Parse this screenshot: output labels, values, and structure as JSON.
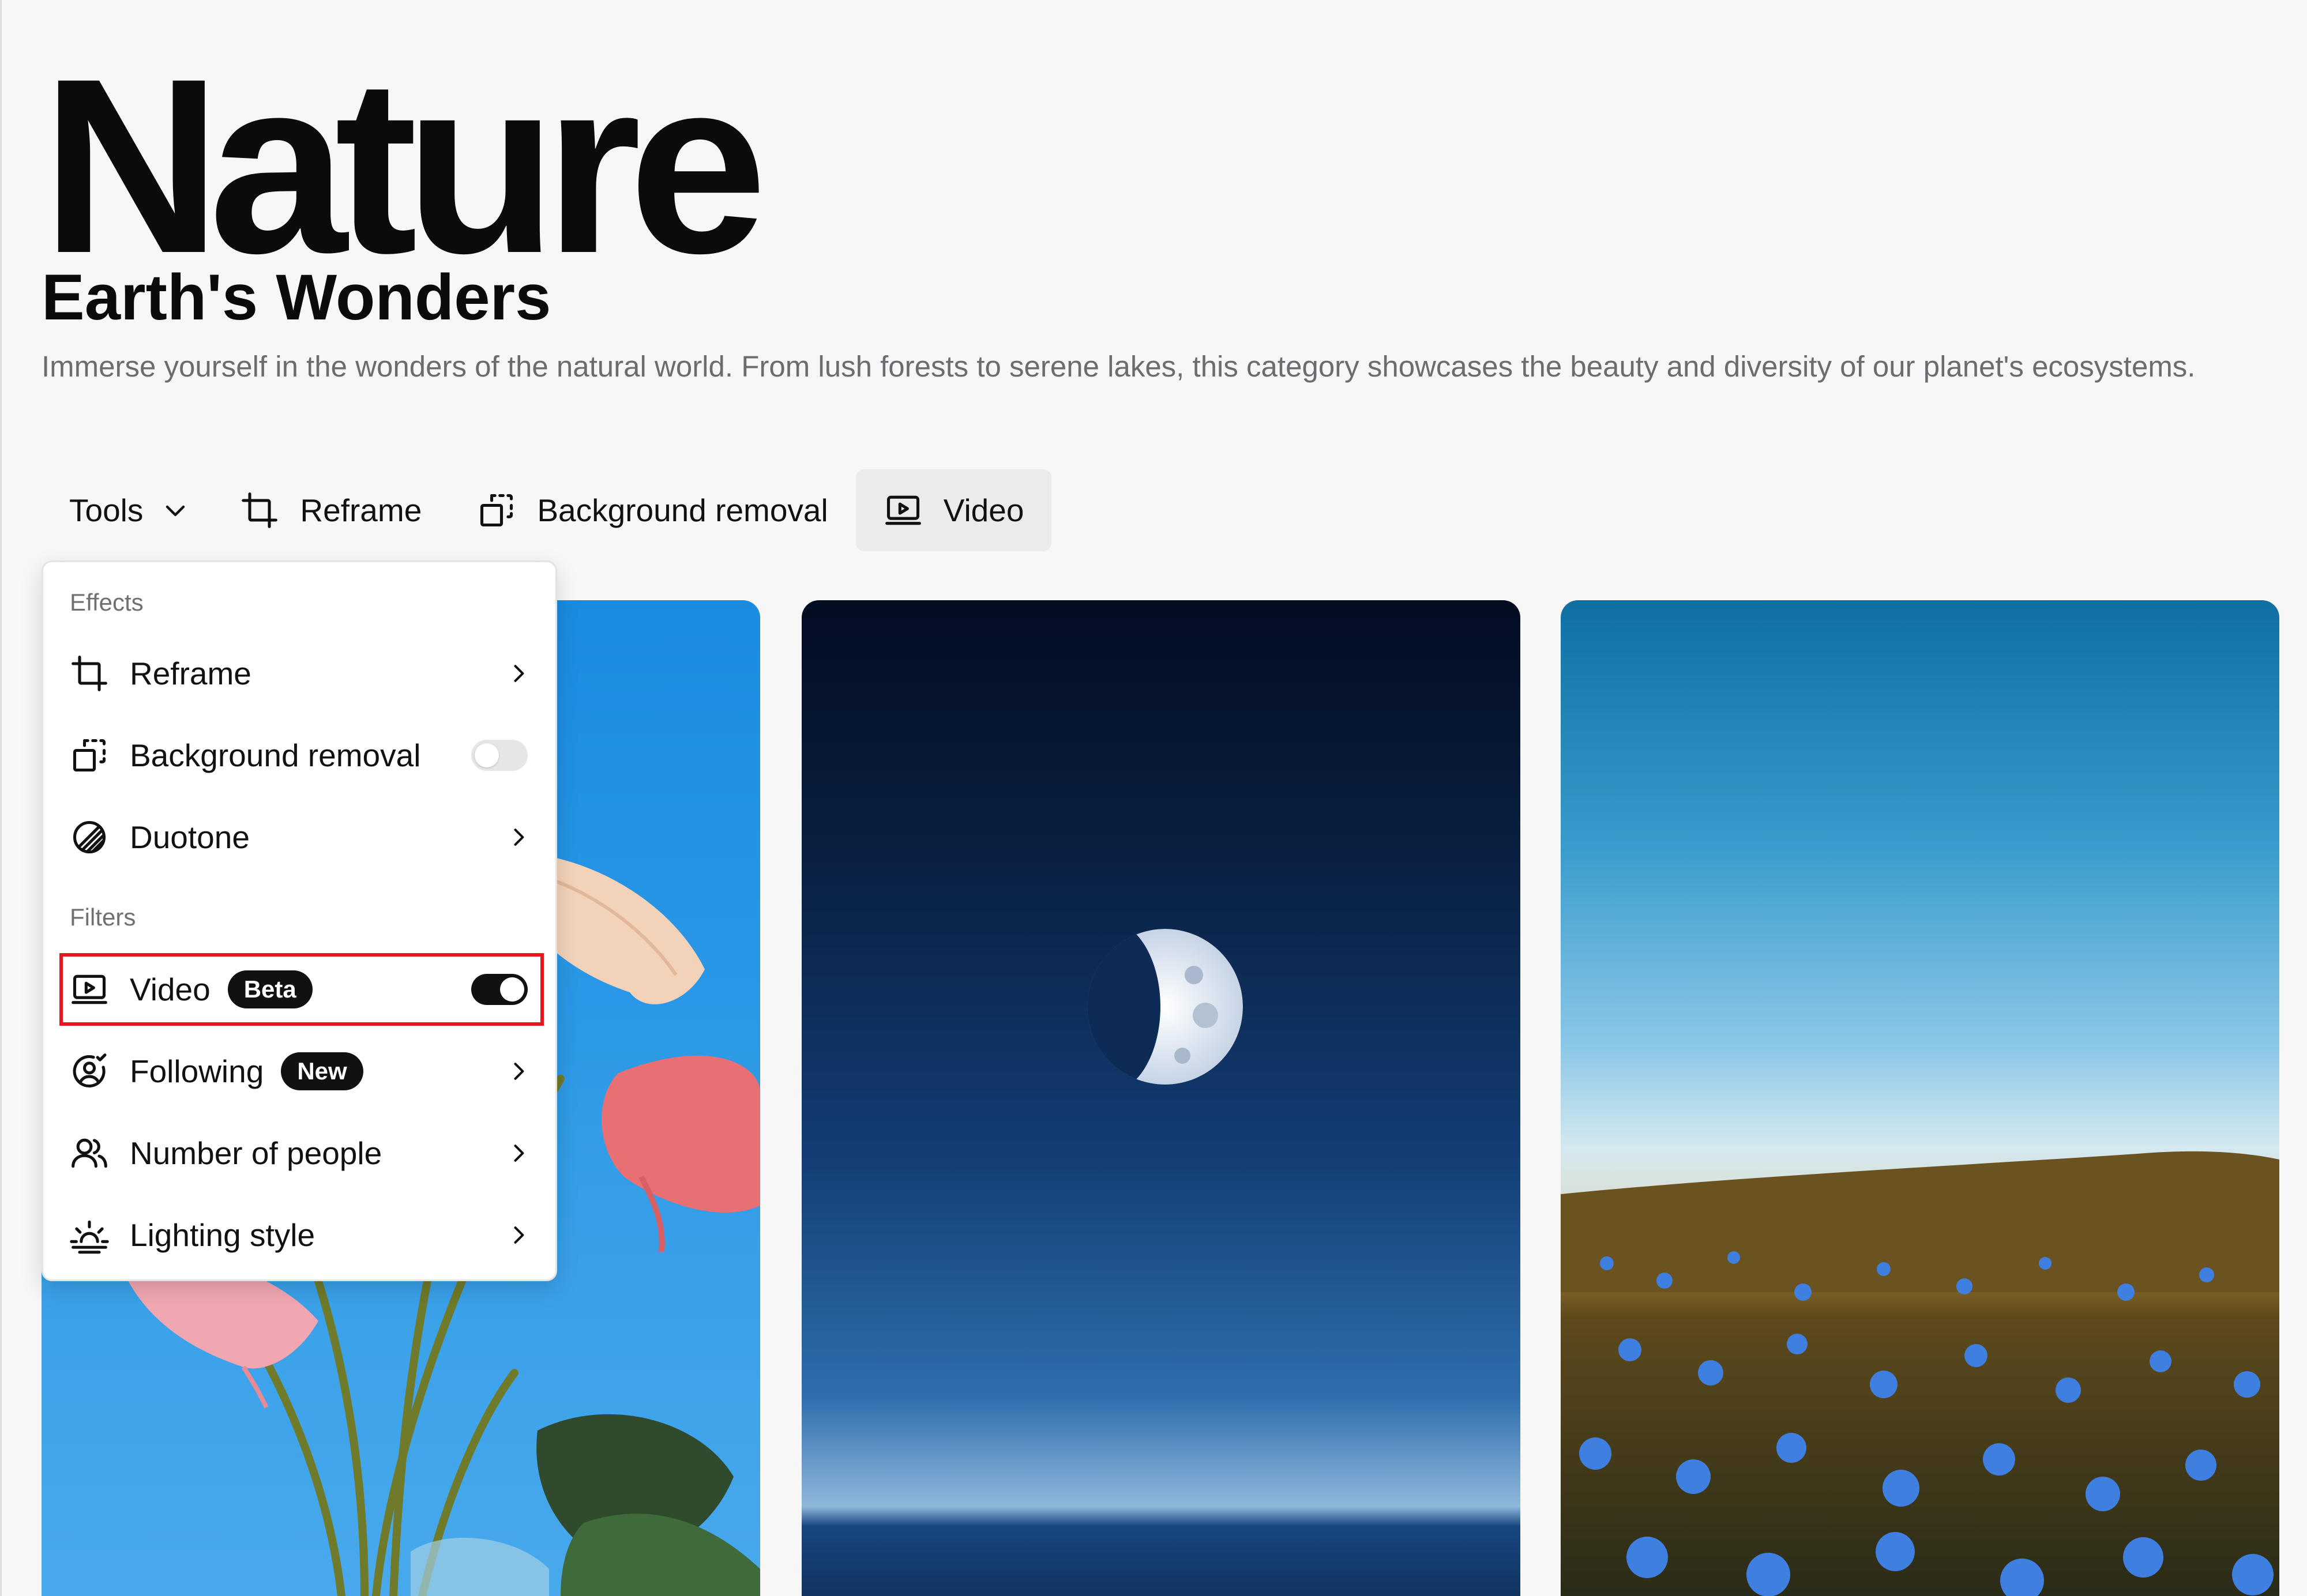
{
  "header": {
    "title": "Nature",
    "subtitle": "Earth's Wonders",
    "description": "Immerse yourself in the wonders of the natural world. From lush forests to serene lakes, this category showcases the beauty and diversity of our planet's ecosystems."
  },
  "toolbar": {
    "tools_label": "Tools",
    "reframe_label": "Reframe",
    "background_removal_label": "Background removal",
    "video_label": "Video",
    "active_item": "Video"
  },
  "menu": {
    "effects_label": "Effects",
    "filters_label": "Filters",
    "items": [
      {
        "label": "Reframe",
        "icon": "crop-icon",
        "control": "chevron"
      },
      {
        "label": "Background removal",
        "icon": "background-removal-icon",
        "control": "toggle",
        "on": false
      },
      {
        "label": "Duotone",
        "icon": "duotone-icon",
        "control": "chevron"
      },
      {
        "label": "Video",
        "icon": "video-icon",
        "badge": "Beta",
        "control": "toggle",
        "on": true,
        "highlighted": true
      },
      {
        "label": "Following",
        "icon": "following-icon",
        "badge": "New",
        "control": "chevron"
      },
      {
        "label": "Number of people",
        "icon": "people-icon",
        "control": "chevron"
      },
      {
        "label": "Lighting style",
        "icon": "sunrise-icon",
        "control": "chevron"
      }
    ]
  },
  "gallery": {
    "images": [
      {
        "subject": "pink anthurium flowers against blue sky"
      },
      {
        "subject": "half moon over the ocean at dusk"
      },
      {
        "subject": "blue wildflower meadow at sunset"
      }
    ]
  },
  "colors": {
    "background": "#f7f7f8",
    "active_tab_bg": "#ebebed",
    "badge_bg": "#111111",
    "toggle_on": "#111111",
    "toggle_off": "#e6e6e8",
    "highlight_border": "#e8141e"
  }
}
